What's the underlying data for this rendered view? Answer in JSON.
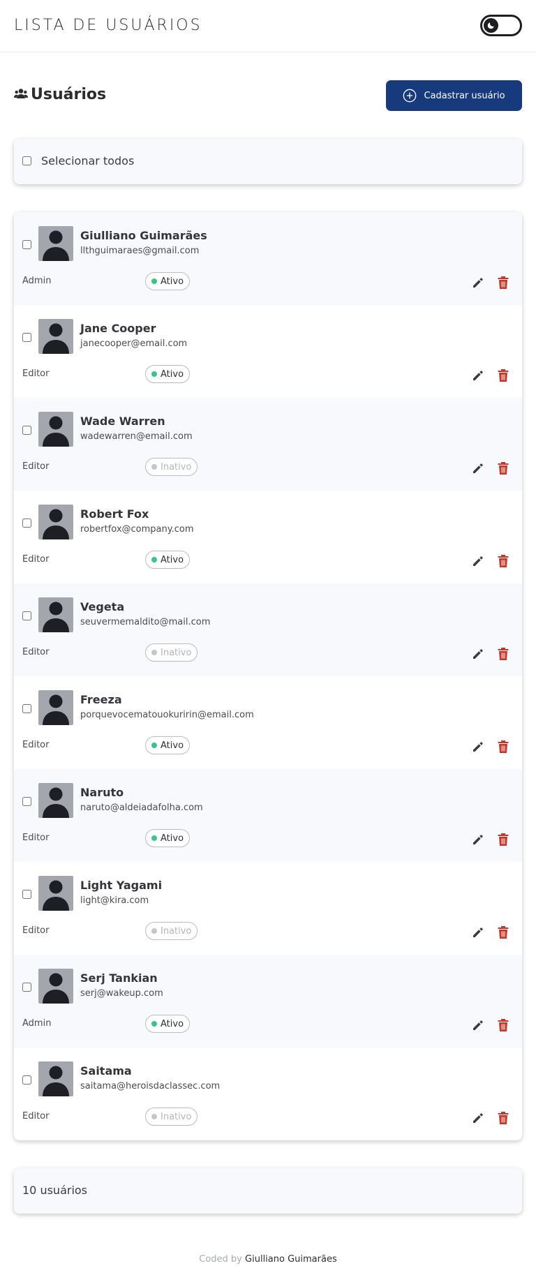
{
  "header": {
    "title": "LISTA DE USUÁRIOS",
    "theme_toggle_icon": "moon-icon"
  },
  "section": {
    "title": "Usuários",
    "icon": "users-icon",
    "add_button_label": "Cadastrar usuário",
    "add_button_icon": "plus-circle-icon"
  },
  "select_all": {
    "label": "Selecionar todos"
  },
  "users": [
    {
      "name": "Giulliano Guimarães",
      "email": "llthguimaraes@gmail.com",
      "role": "Admin",
      "status": "Ativo"
    },
    {
      "name": "Jane Cooper",
      "email": "janecooper@email.com",
      "role": "Editor",
      "status": "Ativo"
    },
    {
      "name": "Wade Warren",
      "email": "wadewarren@email.com",
      "role": "Editor",
      "status": "Inativo"
    },
    {
      "name": "Robert Fox",
      "email": "robertfox@company.com",
      "role": "Editor",
      "status": "Ativo"
    },
    {
      "name": "Vegeta",
      "email": "seuvermemaldito@mail.com",
      "role": "Editor",
      "status": "Inativo"
    },
    {
      "name": "Freeza",
      "email": "porquevocematouokuririn@email.com",
      "role": "Editor",
      "status": "Ativo"
    },
    {
      "name": "Naruto",
      "email": "naruto@aldeiadafolha.com",
      "role": "Editor",
      "status": "Ativo"
    },
    {
      "name": "Light Yagami",
      "email": "light@kira.com",
      "role": "Editor",
      "status": "Inativo"
    },
    {
      "name": "Serj Tankian",
      "email": "serj@wakeup.com",
      "role": "Admin",
      "status": "Ativo"
    },
    {
      "name": "Saitama",
      "email": "saitama@heroisdaclassec.com",
      "role": "Editor",
      "status": "Inativo"
    }
  ],
  "count": {
    "label": "10 usuários"
  },
  "footer": {
    "prefix": "Coded by",
    "author": "Giulliano Guimarães"
  },
  "colors": {
    "primary": "#173a7d",
    "active_dot": "#3cc485",
    "inactive_dot": "#c4c6cb",
    "delete": "#c0392b",
    "edit": "#3a3a40"
  }
}
